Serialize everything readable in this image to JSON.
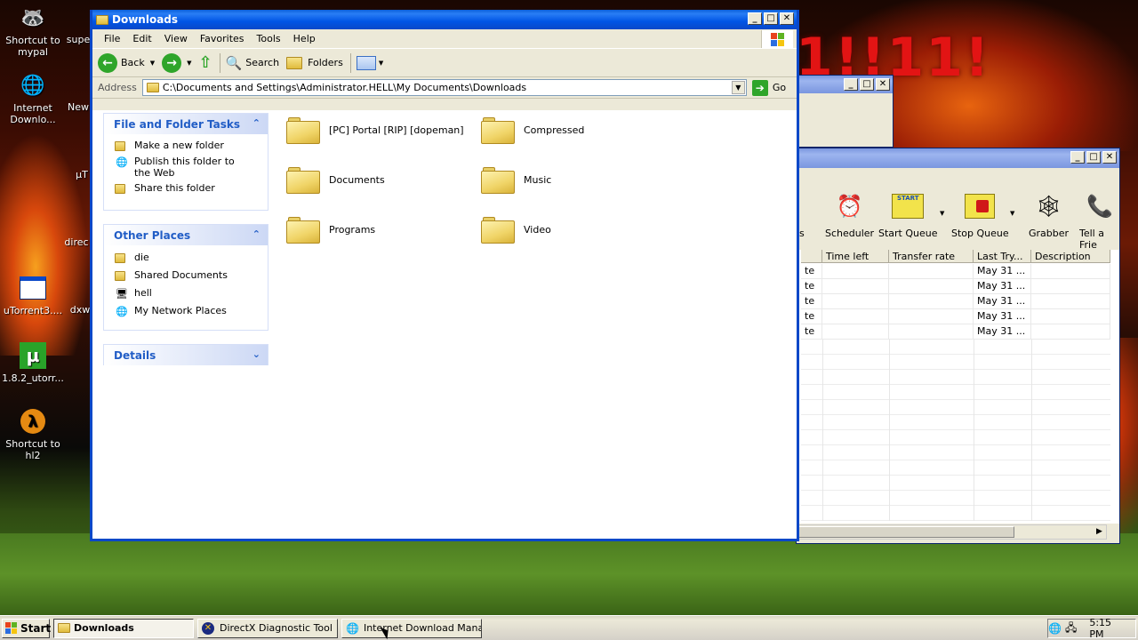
{
  "background": {
    "banner_text": "1!!11!"
  },
  "desktop": {
    "icons": [
      {
        "label": "Shortcut to mypal",
        "icon": "mypal-icon"
      },
      {
        "label": "Internet Downlo...",
        "icon": "idm-icon"
      },
      {
        "label": "New",
        "icon": "new-icon"
      },
      {
        "label": "supe",
        "icon": "app-icon"
      },
      {
        "label": "µT",
        "icon": "utorrent-icon"
      },
      {
        "label": "direc",
        "icon": "directx-icon"
      },
      {
        "label": "uTorrent3....",
        "icon": "setup-icon"
      },
      {
        "label": "dxw",
        "icon": "dx-icon"
      },
      {
        "label": "1.8.2_utorr...",
        "icon": "utorrent-green-icon"
      },
      {
        "label": "Shortcut to hl2",
        "icon": "hl2-icon"
      }
    ]
  },
  "explorer": {
    "title": "Downloads",
    "menu": [
      "File",
      "Edit",
      "View",
      "Favorites",
      "Tools",
      "Help"
    ],
    "toolbar": {
      "back": "Back",
      "search": "Search",
      "folders": "Folders"
    },
    "address": {
      "label": "Address",
      "path": "C:\\Documents and Settings\\Administrator.HELL\\My Documents\\Downloads",
      "go": "Go"
    },
    "file_tasks": {
      "title": "File and Folder Tasks",
      "items": [
        "Make a new folder",
        "Publish this folder to the Web",
        "Share this folder"
      ]
    },
    "other_places": {
      "title": "Other Places",
      "items": [
        "die",
        "Shared Documents",
        "hell",
        "My Network Places"
      ]
    },
    "details": {
      "title": "Details"
    },
    "folders": [
      "[PC] Portal [RIP] [dopeman]",
      "Compressed",
      "Documents",
      "Music",
      "Programs",
      "Video"
    ]
  },
  "idm": {
    "toolbar": [
      "Scheduler",
      "Start Queue",
      "Stop Queue",
      "Grabber",
      "Tell a Frie"
    ],
    "partial_tool": "s",
    "start_badge": "START",
    "columns": [
      "Time left",
      "Transfer rate",
      "Last Try...",
      "Description"
    ],
    "rows": [
      {
        "status": "te",
        "last_try": "May 31 ..."
      },
      {
        "status": "te",
        "last_try": "May 31 ..."
      },
      {
        "status": "te",
        "last_try": "May 31 ..."
      },
      {
        "status": "te",
        "last_try": "May 31 ..."
      },
      {
        "status": "te",
        "last_try": "May 31 ..."
      }
    ]
  },
  "taskbar": {
    "start": "Start",
    "buttons": [
      "Downloads",
      "DirectX Diagnostic Tool",
      "Internet Download Mana..."
    ],
    "clock": "5:15 PM"
  }
}
